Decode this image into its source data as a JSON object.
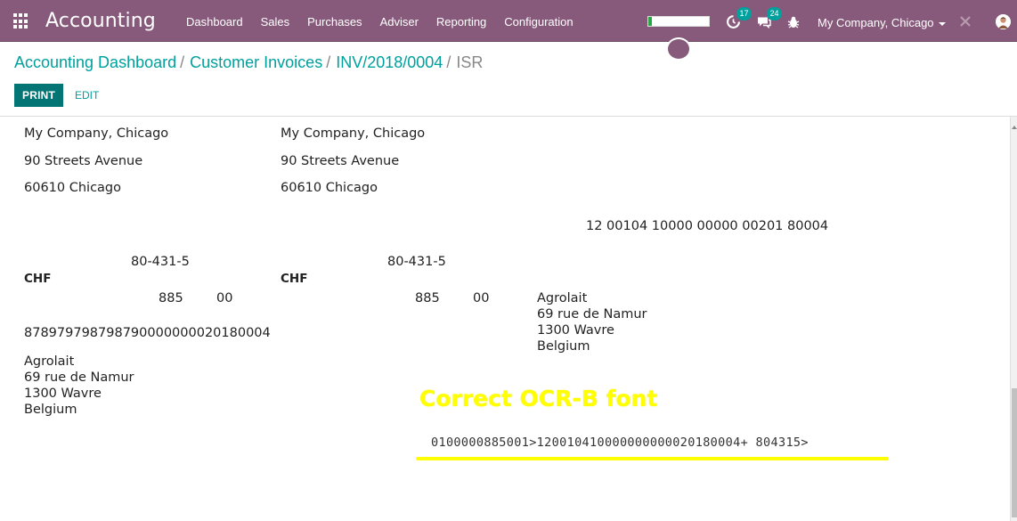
{
  "app": {
    "title": "Accounting"
  },
  "menu": {
    "items": [
      "Dashboard",
      "Sales",
      "Purchases",
      "Adviser",
      "Reporting",
      "Configuration"
    ]
  },
  "systray": {
    "activities_icon": "clock-icon",
    "activities_count": "17",
    "messages_icon": "chat-icon",
    "messages_count": "24",
    "debug_icon": "bug-icon",
    "company": "My Company, Chicago",
    "close_icon": "close-icon",
    "avatar_icon": "user-avatar-icon",
    "loading_progress": 0.06,
    "accent_color": "#875a7b",
    "badge_color": "#00a09d"
  },
  "breadcrumb": {
    "items": [
      "Accounting Dashboard",
      "Customer Invoices",
      "INV/2018/0004"
    ],
    "active": "ISR",
    "separator": "/"
  },
  "buttons": {
    "print": "PRINT",
    "edit": "EDIT"
  },
  "isr": {
    "receipt": {
      "company_name": "My Company, Chicago",
      "company_street": "90 Streets Avenue",
      "company_city": "60610 Chicago",
      "account": "80-431-5",
      "currency": "CHF",
      "amount_units": "885",
      "amount_cents": "00",
      "reference": "878979798798790000000020180004",
      "debtor_name": "Agrolait",
      "debtor_street": "69 rue de Namur",
      "debtor_city": "1300 Wavre",
      "debtor_country": "Belgium"
    },
    "payment": {
      "company_name": "My Company, Chicago",
      "company_street": "90 Streets Avenue",
      "company_city": "60610 Chicago",
      "reference_formatted": "12 00104 10000 00000 00201 80004",
      "account": "80-431-5",
      "currency": "CHF",
      "amount_units": "885",
      "amount_cents": "00",
      "debtor_name": "Agrolait",
      "debtor_street": "69 rue de Namur",
      "debtor_city": "1300 Wavre",
      "debtor_country": "Belgium"
    },
    "annotation": "Correct OCR-B font",
    "ocr_line": "0100000885001>120010410000000000020180004+ 804315>",
    "highlight_color": "#ffff00"
  }
}
